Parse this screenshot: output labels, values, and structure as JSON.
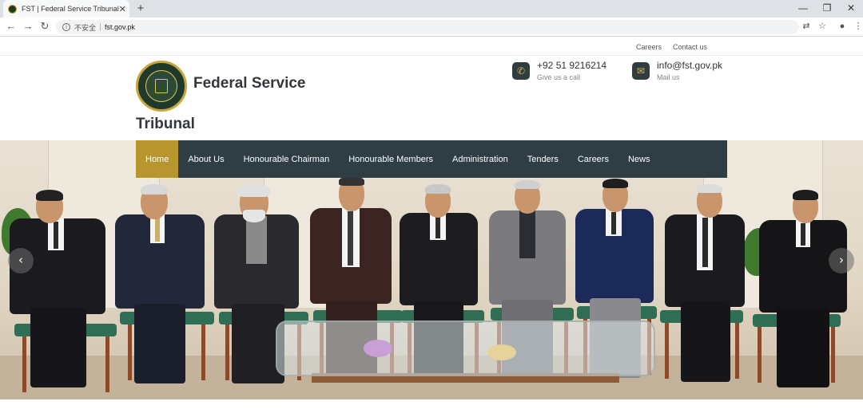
{
  "browser": {
    "tab_title": "FST | Federal Service Tribunal",
    "tab_close": "✕",
    "new_tab": "+",
    "security_label": "不安全",
    "url": "fst.gov.pk",
    "window_controls": [
      "—",
      "❐",
      "✕"
    ]
  },
  "site": {
    "top_links": [
      "Careers",
      "Contact us"
    ],
    "brand_line1": "Federal Service",
    "brand_line2": "Tribunal",
    "contacts": {
      "phone": {
        "value": "+92 51 9216214",
        "caption": "Give us a call",
        "icon": "phone-icon"
      },
      "email": {
        "value": "info@fst.gov.pk",
        "caption": "Mail us",
        "icon": "mail-icon"
      }
    },
    "nav": {
      "items": [
        "Home",
        "About Us",
        "Honourable Chairman",
        "Honourable Members",
        "Administration",
        "Tenders",
        "Careers",
        "News"
      ],
      "active": "Home",
      "active_color": "#b8962e",
      "bar_color": "#2f3d45"
    },
    "slider": {
      "prev": "‹",
      "next": "›"
    }
  }
}
